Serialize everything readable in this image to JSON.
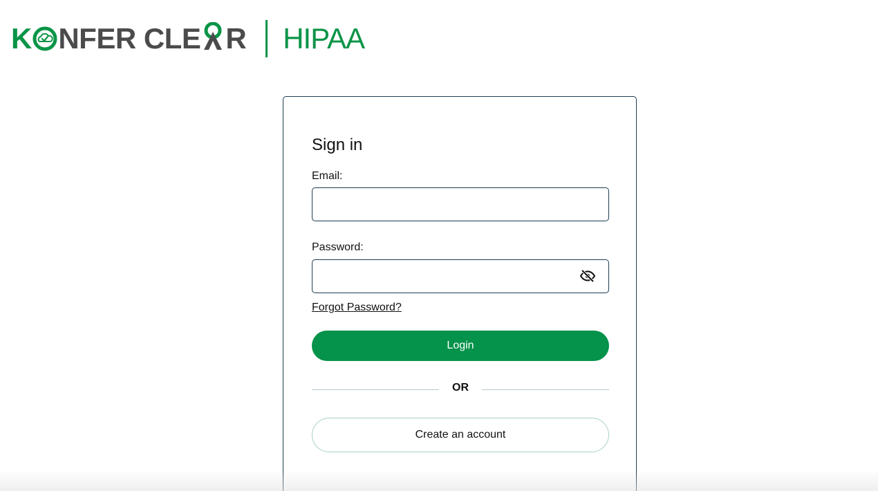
{
  "brand": {
    "name_k": "K",
    "name_rest_1": "NFER CLE",
    "name_rest_2": "R",
    "product": "HIPAA",
    "accent_color": "#0a9447",
    "text_color": "#4b4b4b",
    "logo_icon": "cloud-check-icon"
  },
  "signin": {
    "title": "Sign in",
    "email_label": "Email:",
    "email_value": "",
    "email_placeholder": "",
    "password_label": "Password:",
    "password_value": "",
    "password_placeholder": "",
    "toggle_visibility_icon": "eye-off-icon",
    "forgot_password": "Forgot Password?",
    "login_button": "Login",
    "divider_text": "OR",
    "create_account_button": "Create an account",
    "primary_color": "#05924a",
    "border_color": "#1d3b4f"
  }
}
